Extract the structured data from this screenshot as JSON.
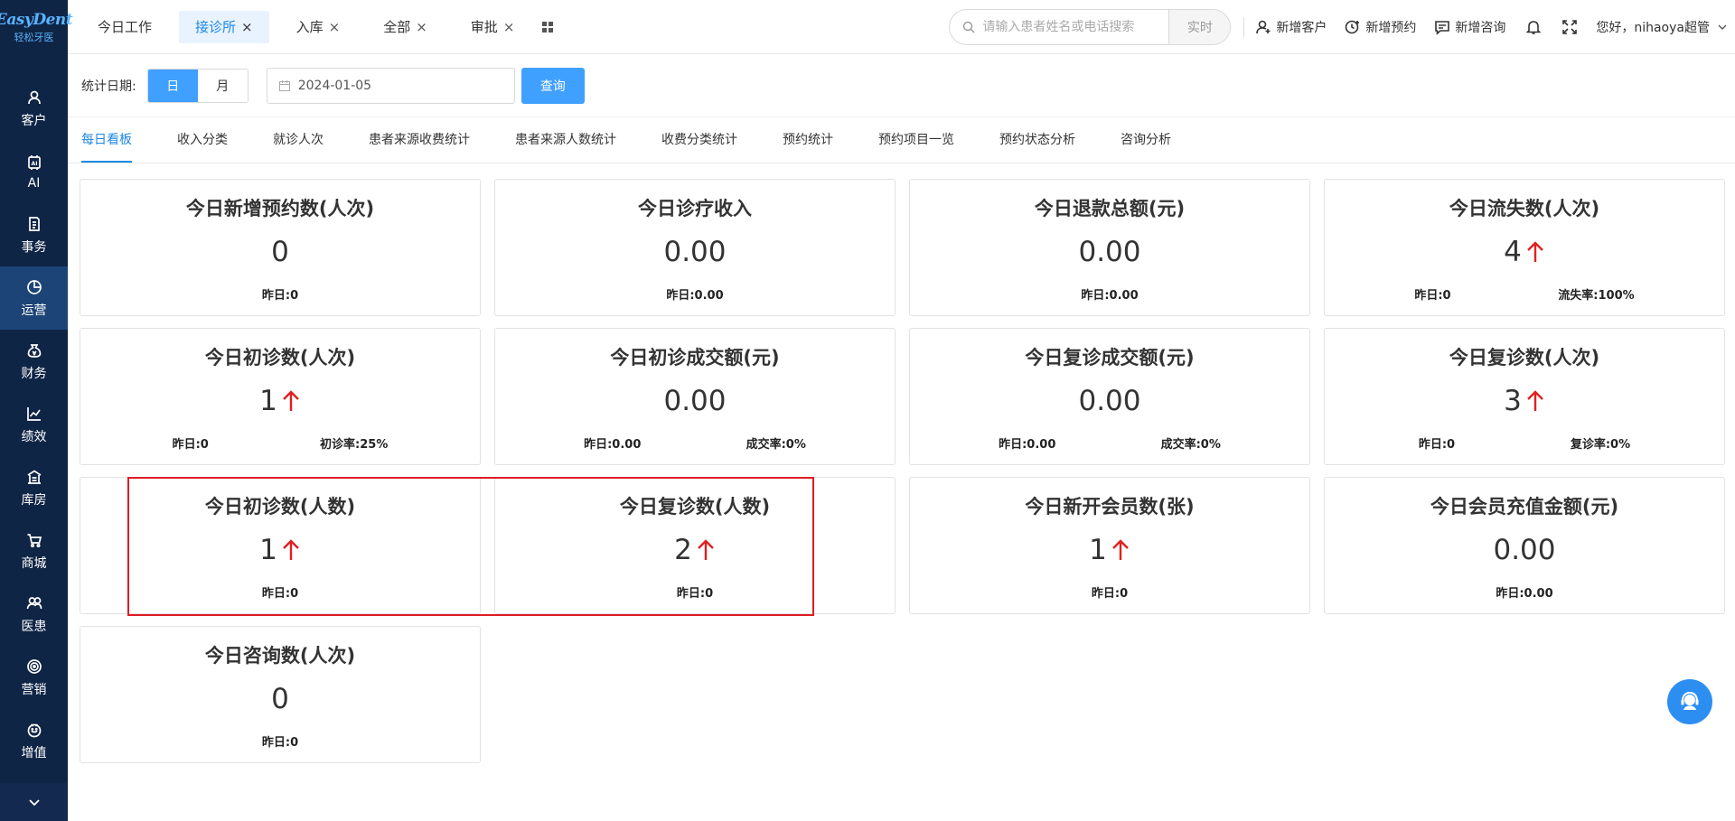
{
  "logo": {
    "main": "EasyDent",
    "sub": "轻松牙医"
  },
  "sidebar": {
    "items": [
      {
        "label": "客户",
        "icon": "user-icon"
      },
      {
        "label": "AI",
        "icon": "ai-chip-icon"
      },
      {
        "label": "事务",
        "icon": "document-icon"
      },
      {
        "label": "运营",
        "icon": "pie-chart-icon",
        "active": true
      },
      {
        "label": "财务",
        "icon": "money-bag-icon"
      },
      {
        "label": "绩效",
        "icon": "line-chart-icon"
      },
      {
        "label": "库房",
        "icon": "warehouse-icon"
      },
      {
        "label": "商城",
        "icon": "cart-icon"
      },
      {
        "label": "医患",
        "icon": "people-icon"
      },
      {
        "label": "营销",
        "icon": "target-icon"
      },
      {
        "label": "增值",
        "icon": "gift-icon"
      }
    ]
  },
  "header": {
    "tabs": [
      {
        "label": "今日工作",
        "closable": false
      },
      {
        "label": "接诊所",
        "closable": true,
        "active": true
      },
      {
        "label": "入库",
        "closable": true
      },
      {
        "label": "全部",
        "closable": true
      },
      {
        "label": "审批",
        "closable": true
      }
    ],
    "search_placeholder": "请输入患者姓名或电话搜索",
    "search_button": "实时",
    "actions": {
      "new_customer": "新增客户",
      "new_appointment": "新增预约",
      "new_consult": "新增咨询"
    },
    "user_greeting": "您好，nihaoya超管"
  },
  "filter": {
    "label": "统计日期:",
    "day": "日",
    "month": "月",
    "date": "2024-01-05",
    "query": "查询"
  },
  "subtabs": [
    "每日看板",
    "收入分类",
    "就诊人次",
    "患者来源收费统计",
    "患者来源人数统计",
    "收费分类统计",
    "预约统计",
    "预约项目一览",
    "预约状态分析",
    "咨询分析"
  ],
  "cards": [
    {
      "title": "今日新增预约数(人次)",
      "value": "0",
      "up": false,
      "foot_left": "昨日:0"
    },
    {
      "title": "今日诊疗收入",
      "value": "0.00",
      "up": false,
      "foot_left": "昨日:0.00"
    },
    {
      "title": "今日退款总额(元)",
      "value": "0.00",
      "up": false,
      "foot_left": "昨日:0.00"
    },
    {
      "title": "今日流失数(人次)",
      "value": "4",
      "up": true,
      "foot_left": "昨日:0",
      "foot_right": "流失率:100%"
    },
    {
      "title": "今日初诊数(人次)",
      "value": "1",
      "up": true,
      "foot_left": "昨日:0",
      "foot_right": "初诊率:25%"
    },
    {
      "title": "今日初诊成交额(元)",
      "value": "0.00",
      "up": false,
      "foot_left": "昨日:0.00",
      "foot_right": "成交率:0%"
    },
    {
      "title": "今日复诊成交额(元)",
      "value": "0.00",
      "up": false,
      "foot_left": "昨日:0.00",
      "foot_right": "成交率:0%"
    },
    {
      "title": "今日复诊数(人次)",
      "value": "3",
      "up": true,
      "foot_left": "昨日:0",
      "foot_right": "复诊率:0%"
    },
    {
      "title": "今日初诊数(人数)",
      "value": "1",
      "up": true,
      "foot_left": "昨日:0"
    },
    {
      "title": "今日复诊数(人数)",
      "value": "2",
      "up": true,
      "foot_left": "昨日:0"
    },
    {
      "title": "今日新开会员数(张)",
      "value": "1",
      "up": true,
      "foot_left": "昨日:0"
    },
    {
      "title": "今日会员充值金额(元)",
      "value": "0.00",
      "up": false,
      "foot_left": "昨日:0.00"
    },
    {
      "title": "今日咨询数(人次)",
      "value": "0",
      "up": false,
      "foot_left": "昨日:0"
    }
  ],
  "colors": {
    "sidebar_bg": "#0f2546",
    "accent": "#40a0ff",
    "up_arrow": "#e02020",
    "highlight": "#e01b24"
  }
}
